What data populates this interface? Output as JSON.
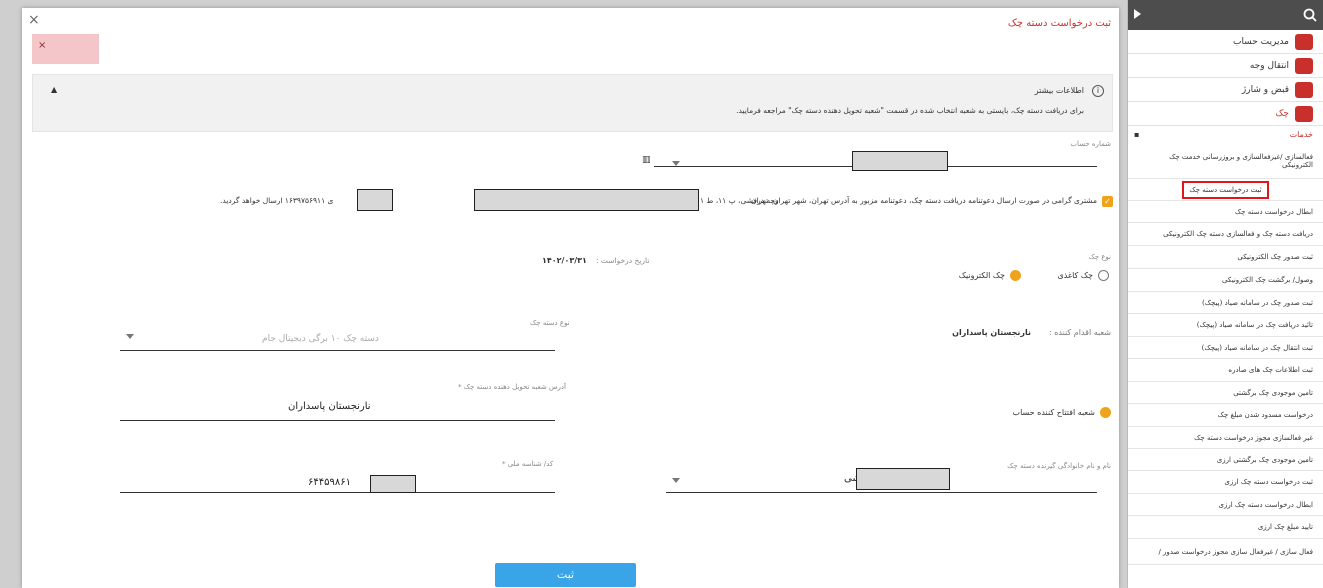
{
  "sidebar": {
    "menu": [
      {
        "label": "مدیریت حساب",
        "icon": "account-icon",
        "color": "#c9302c"
      },
      {
        "label": "انتقال وجه",
        "icon": "transfer-icon",
        "color": "#c9302c"
      },
      {
        "label": "قبض و شارژ",
        "icon": "bill-icon",
        "color": "#c9302c"
      },
      {
        "label": "چک",
        "icon": "check-icon",
        "color": "#c9302c"
      }
    ],
    "section_label": "خدمات",
    "items": [
      "فعالسازی /غیرفعالسازی و بروزرسانی خدمت چک الکترونیکی",
      "ثبت درخواست دسته چک",
      "ابطال درخواست دسته چک",
      "دریافت دسته چک و فعالسازی دسته چک الکترونیکی",
      "ثبت صدور چک الکترونیکی",
      "وصول/ برگشت چک الکترونیکی",
      "ثبت صدور چک در سامانه صیاد (پیچک)",
      "تائید دریافت چک در سامانه صیاد (پیچک)",
      "ثبت انتقال چک در سامانه صیاد (پیچک)",
      "ثبت اطلاعات چک های صادره",
      "تامین موجودی چک برگشتی",
      "درخواست مسدود شدن مبلغ چک",
      "غیر فعالسازی مجوز درخواست دسته چک",
      "تامین موجودی چک برگشتی ارزی",
      "ثبت درخواست دسته چک ارزی",
      "ابطال درخواست دسته چک ارزی",
      "تایید مبلغ چک ارزی",
      "فعال سازی / غیرفعال سازی مجوز درخواست صدور /"
    ],
    "selected_index": 1
  },
  "modal": {
    "title": "ثبت درخواست دسته چک",
    "close": "×",
    "alert_close": "×",
    "info_title": "اطلاعات بیشتر",
    "info_icon": "i",
    "info_text": "برای دریافت دسته چک، بایستی به شعبه انتخاب شده در قسمت \"شعبه تحویل دهنده دسته چک\" مراجعه فرمایید.",
    "info_toggle": "▲",
    "account_label": "شماره حساب",
    "notice_part1": "مشتری گرامی در صورت ارسال دعوتنامه دریافت دسته چک، دعوتنامه مزبور به آدرس تهران، شهر تهران، تهران",
    "notice_part2": "وچه درفشی، پ ۱۱، ط ۱",
    "notice_part3": "ی ۱۶۳۹۷۵۶۹۱۱ ارسال خواهد گردید.",
    "check_type_label": "نوع چک",
    "paper_check": "چک کاغذی",
    "electronic_check": "چک الکترونیک",
    "request_date_label": "تاریخ درخواست :",
    "request_date": "۱۴۰۲/۰۳/۳۱",
    "checkbook_type_label": "نوع دسته چک",
    "checkbook_type_value": "دسته چک ۱۰ برگی دیجیتال جام",
    "branch_action_label": "شعبه اقدام کننده :",
    "branch_action_value": "نارنجستان پاسداران",
    "delivery_branch_label": "آدرس شعبه تحویل دهنده دسته چک *",
    "delivery_branch_value": "نارنجستان پاسداران",
    "opening_branch": "شعبه افتتاح کننده حساب",
    "national_id_label": "کد/ شناسه ملی *",
    "national_id_value": "۶۴۴۵۹۸۶۱",
    "receiver_name_label": "نام و نام خانوادگی گیرنده دسته چک",
    "receiver_name_value": "شی",
    "submit": "ثبت"
  }
}
